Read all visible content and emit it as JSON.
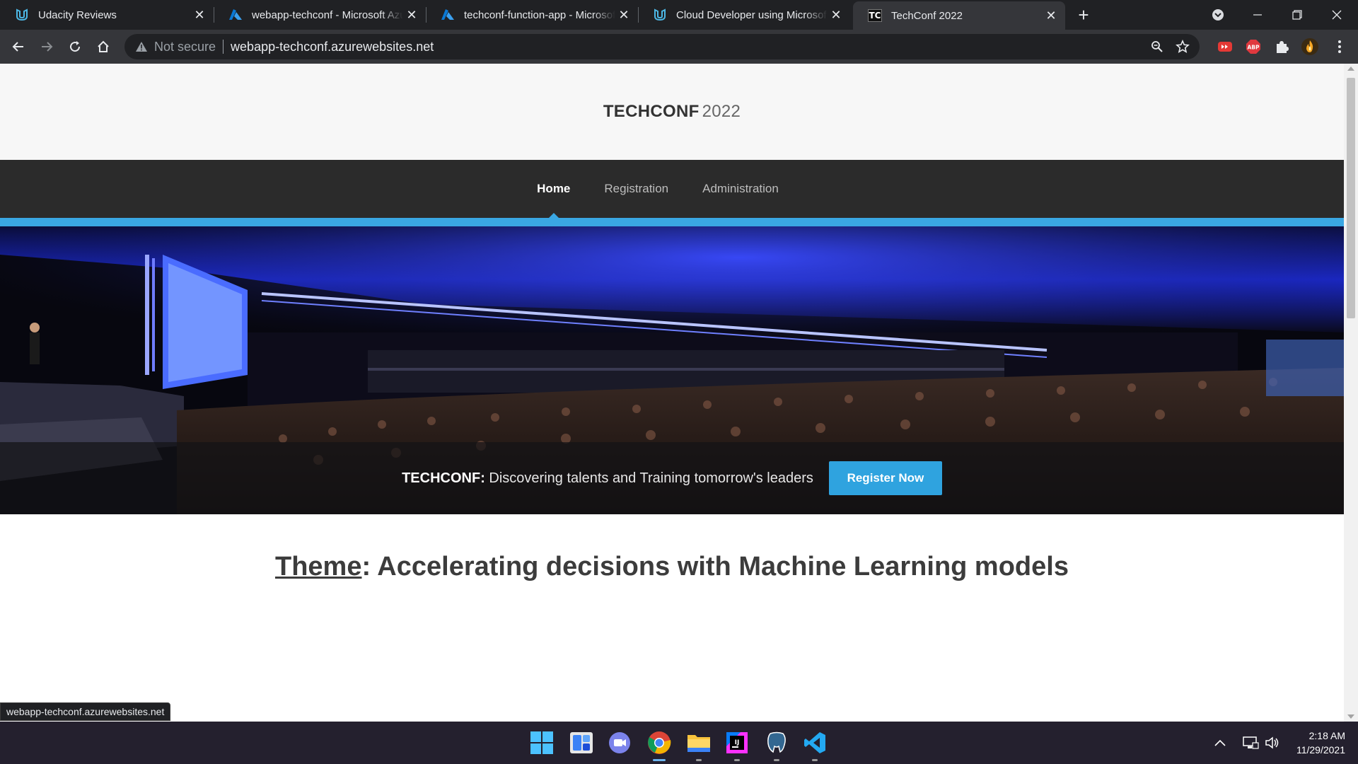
{
  "browser": {
    "tabs": [
      {
        "title": "Udacity Reviews",
        "icon": "udacity-icon",
        "active": false
      },
      {
        "title": "webapp-techconf - Microsoft Azure",
        "icon": "azure-icon",
        "active": false
      },
      {
        "title": "techconf-function-app - Microsoft Azure",
        "icon": "azure-icon",
        "active": false
      },
      {
        "title": "Cloud Developer using Microsoft Azure",
        "icon": "udacity-icon",
        "active": false
      },
      {
        "title": "TechConf 2022",
        "icon": "techconf-favicon",
        "favicon_text": "TC",
        "active": true
      }
    ],
    "security_label": "Not secure",
    "url": "webapp-techconf.azurewebsites.net",
    "status_url": "webapp-techconf.azurewebsites.net",
    "extensions": [
      "youtube-extension-icon",
      "adblock-plus-icon",
      "puzzle-icon",
      "profile-icon"
    ],
    "abp_label": "ABP"
  },
  "site": {
    "logo_strong": "TECHCONF",
    "logo_year": "2022",
    "nav": [
      {
        "label": "Home",
        "active": true
      },
      {
        "label": "Registration",
        "active": false
      },
      {
        "label": "Administration",
        "active": false
      }
    ],
    "hero": {
      "tag_strong": "TECHCONF:",
      "tag_text": " Discovering talents and Training tomorrow's leaders",
      "register_label": "Register Now"
    },
    "theme_label": "Theme",
    "theme_text": ": Accelerating decisions with Machine Learning models"
  },
  "taskbar": {
    "apps": [
      "windows-start-icon",
      "widgets-icon",
      "teams-chat-icon",
      "chrome-icon",
      "file-explorer-icon",
      "intellij-icon",
      "postgres-icon",
      "vscode-icon"
    ],
    "time": "2:18 AM",
    "date": "11/29/2021"
  },
  "colors": {
    "accent": "#3aa7e3",
    "nav_bg": "#2b2b2b",
    "button": "#2fa3df"
  }
}
